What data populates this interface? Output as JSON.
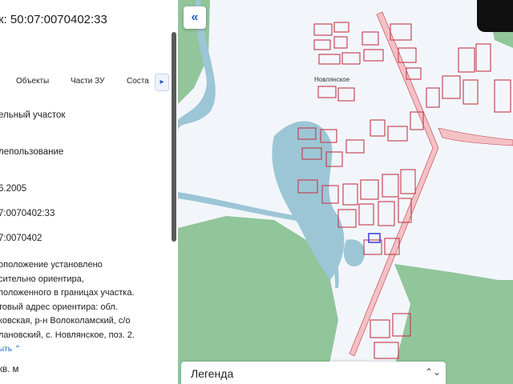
{
  "panel": {
    "title": "к: 50:07:0070402:33",
    "tabs": [
      "Объекты",
      "Части ЗУ",
      "Соста"
    ],
    "tab_arrow": "▸",
    "fields": [
      "ельный участок",
      "лепользование",
      "6.2005",
      "7:0070402:33",
      "7:0070402"
    ],
    "address_lines": [
      "оположение установлено",
      "сительно ориентира,",
      "положенного в границах участка.",
      "товый адрес ориентира: обл.",
      "ковская, р-н Волоколамский, с/о",
      "лановский, с. Новлянское, поз. 2."
    ],
    "show_link": "ыть ⌃",
    "area": "кв. м"
  },
  "map": {
    "collapse_label": "«",
    "village_label": "Новлянское",
    "legend_label": "Легенда",
    "legend_chevron": "⌃⌄"
  },
  "colors": {
    "forest": "#86c08f",
    "water": "#9cc6d6",
    "parcel": "#c43a4a",
    "road": "#f3c1c4",
    "selected": "#3b3bd9"
  }
}
